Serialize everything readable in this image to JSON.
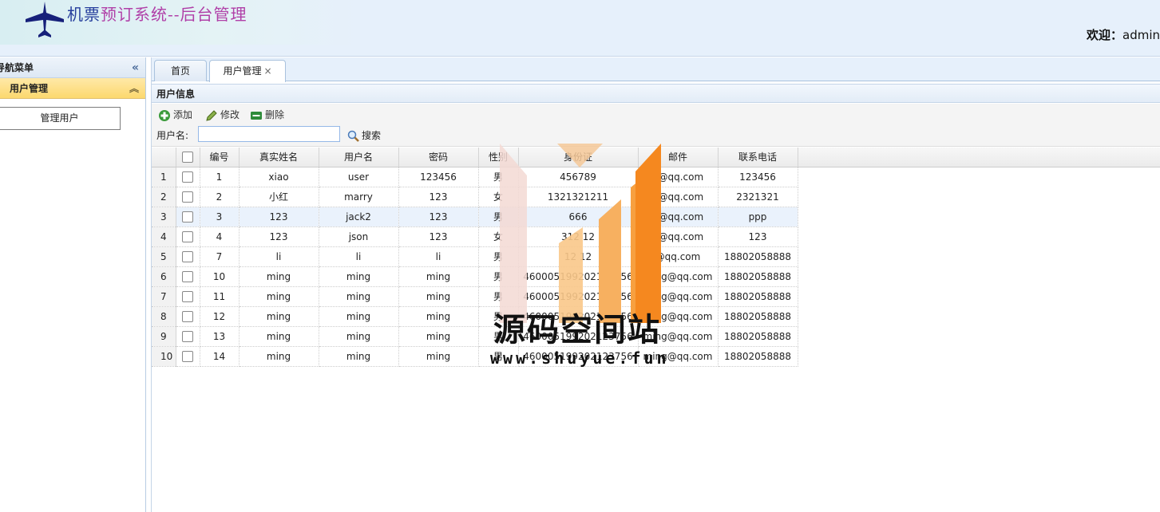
{
  "header": {
    "title_part1": "机票",
    "title_part2": "预订系统--后台管理",
    "welcome_label": "欢迎：",
    "user": "admin"
  },
  "sidebar": {
    "title": "导航菜单",
    "group_label": "用户管理",
    "items": [
      {
        "label": "管理用户"
      }
    ]
  },
  "tabs": [
    {
      "label": "首页"
    },
    {
      "label": "用户管理",
      "close": "×"
    }
  ],
  "panel": {
    "title": "用户信息"
  },
  "toolbar": {
    "add_label": "添加",
    "edit_label": "修改",
    "delete_label": "删除",
    "search_label": "用户名:",
    "search_value": "",
    "search_button": "搜索"
  },
  "grid": {
    "columns": [
      "编号",
      "真实姓名",
      "用户名",
      "密码",
      "性别",
      "身份证",
      "邮件",
      "联系电话"
    ],
    "rows": [
      {
        "rn": "1",
        "id": "1",
        "name": "xiao",
        "user": "user",
        "pwd": "123456",
        "sex": "男",
        "card": "456789",
        "mail": "4@qq.com",
        "phone": "123456"
      },
      {
        "rn": "2",
        "id": "2",
        "name": "小红",
        "user": "marry",
        "pwd": "123",
        "sex": "女",
        "card": "1321321211",
        "mail": "4@qq.com",
        "phone": "2321321"
      },
      {
        "rn": "3",
        "id": "3",
        "name": "123",
        "user": "jack2",
        "pwd": "123",
        "sex": "男",
        "card": "666",
        "mail": "3@qq.com",
        "phone": "ppp"
      },
      {
        "rn": "4",
        "id": "4",
        "name": "123",
        "user": "json",
        "pwd": "123",
        "sex": "女",
        "card": "312 12",
        "mail": "3@qq.com",
        "phone": "123"
      },
      {
        "rn": "5",
        "id": "7",
        "name": "li",
        "user": "li",
        "pwd": "li",
        "sex": "男",
        "card": "12 12",
        "mail": "@qq.com",
        "phone": "18802058888"
      },
      {
        "rn": "6",
        "id": "10",
        "name": "ming",
        "user": "ming",
        "pwd": "ming",
        "sex": "男",
        "card": "460005199202123756",
        "mail": "ming@qq.com",
        "phone": "18802058888"
      },
      {
        "rn": "7",
        "id": "11",
        "name": "ming",
        "user": "ming",
        "pwd": "ming",
        "sex": "男",
        "card": "460005199202123756",
        "mail": "ming@qq.com",
        "phone": "18802058888"
      },
      {
        "rn": "8",
        "id": "12",
        "name": "ming",
        "user": "ming",
        "pwd": "ming",
        "sex": "男",
        "card": "460005199202123756",
        "mail": "ming@qq.com",
        "phone": "18802058888"
      },
      {
        "rn": "9",
        "id": "13",
        "name": "ming",
        "user": "ming",
        "pwd": "ming",
        "sex": "男",
        "card": "460005199202123756",
        "mail": "ming@qq.com",
        "phone": "18802058888"
      },
      {
        "rn": "10",
        "id": "14",
        "name": "ming",
        "user": "ming",
        "pwd": "ming",
        "sex": "男",
        "card": "460005199202123756",
        "mail": "ming@qq.com",
        "phone": "18802058888"
      }
    ],
    "highlight_row": 3
  },
  "watermark": {
    "line1": "源码空间站",
    "line2": "www.shuyue.fun"
  },
  "colors": {
    "header_bg": "#e6f0fb",
    "group_bg": "#fcd86e",
    "title_blue": "#243d9c",
    "title_magenta": "#b040a8",
    "watermark_orange": "#f5881f"
  }
}
